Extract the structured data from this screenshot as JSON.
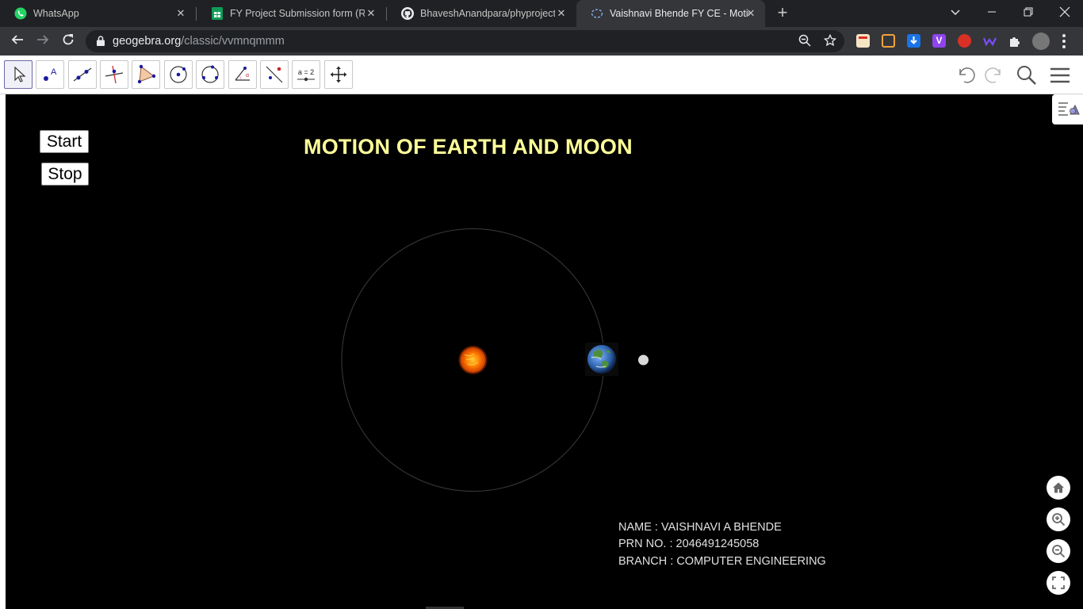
{
  "browser": {
    "tabs": [
      {
        "title": "WhatsApp",
        "icon": "whatsapp-icon",
        "active": false
      },
      {
        "title": "FY Project Submission form (Resp",
        "icon": "google-sheets-icon",
        "active": false
      },
      {
        "title": "BhaveshAnandpara/phyproject: A",
        "icon": "github-icon",
        "active": false
      },
      {
        "title": "Vaishnavi Bhende FY CE - Motion",
        "icon": "geogebra-loading-icon",
        "active": true
      }
    ],
    "url_host": "geogebra.org",
    "url_path": "/classic/vvmnqmmm"
  },
  "toolbar": {
    "tools": [
      "move-tool-icon",
      "point-tool-icon",
      "line-tool-icon",
      "perpendicular-line-tool-icon",
      "polygon-tool-icon",
      "circle-center-point-tool-icon",
      "circle-three-points-tool-icon",
      "angle-tool-icon",
      "reflect-tool-icon",
      "slider-tool-icon",
      "move-graphics-view-tool-icon"
    ],
    "slider_label": "a = 2"
  },
  "canvas": {
    "start_button": "Start",
    "stop_button": "Stop",
    "title": "MOTION OF EARTH AND MOON",
    "info": {
      "name": "NAME : VAISHNAVI A BHENDE",
      "prn": "PRN NO. : 2046491245058",
      "branch": "BRANCH : COMPUTER ENGINEERING"
    },
    "colors": {
      "background": "#000000",
      "title": "#ffff99",
      "orbit": "#3a3a3a",
      "sun": "#ff6a00",
      "moon": "#d9d9d9"
    }
  }
}
